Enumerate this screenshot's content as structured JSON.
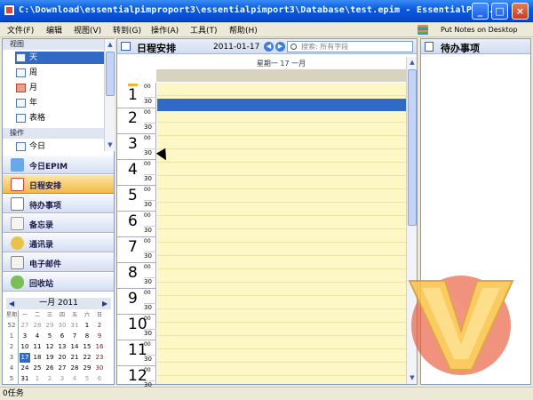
{
  "window": {
    "title": "C:\\Download\\essentialpimproport3\\essentialpimport3\\Database\\test.epim - EssentialPIM...",
    "minimize": "_",
    "maximize": "□",
    "close": "×"
  },
  "menu": {
    "items": [
      "文件(F)",
      "编辑",
      "视图(V)",
      "转到(G)",
      "操作(A)",
      "工具(T)",
      "帮助(H)"
    ],
    "notes_button": "Put Notes on Desktop"
  },
  "left": {
    "views_header": "视图",
    "views": [
      "天",
      "周",
      "月",
      "年",
      "表格"
    ],
    "actions_header": "操作",
    "actions": [
      "今日"
    ],
    "nav": [
      "今日EPIM",
      "日程安排",
      "待办事项",
      "备忘录",
      "通讯录",
      "电子邮件",
      "回收站"
    ],
    "active_nav": "日程安排",
    "minical": {
      "month_label": "一月 2011",
      "prev": "◀",
      "next": "▶",
      "header": [
        "星期",
        "一",
        "二",
        "三",
        "四",
        "五",
        "六",
        "日"
      ],
      "weeks": [
        [
          "52",
          "27",
          "28",
          "29",
          "30",
          "31",
          "1",
          "2"
        ],
        [
          "1",
          "3",
          "4",
          "5",
          "6",
          "7",
          "8",
          "9"
        ],
        [
          "2",
          "10",
          "11",
          "12",
          "13",
          "14",
          "15",
          "16"
        ],
        [
          "3",
          "17",
          "18",
          "19",
          "20",
          "21",
          "22",
          "23"
        ],
        [
          "4",
          "24",
          "25",
          "26",
          "27",
          "28",
          "29",
          "30"
        ],
        [
          "5",
          "31",
          "1",
          "2",
          "3",
          "4",
          "5",
          "6"
        ]
      ],
      "today": "17"
    }
  },
  "calendar": {
    "title": "日程安排",
    "date": "2011-01-17",
    "search_placeholder": "搜索: 所有字段",
    "day_header": "星期一 17 一月",
    "hours": [
      "1",
      "2",
      "3",
      "4",
      "5",
      "6",
      "7",
      "8",
      "9",
      "10",
      "11",
      "12"
    ],
    "min00": "00",
    "min30": "30"
  },
  "todo": {
    "title": "待办事项"
  },
  "status": {
    "text": "0任务"
  },
  "colors": {
    "titlebar": "#0a58e0",
    "selection": "#316ac5",
    "grid_bg": "#fcf7c5",
    "active_nav": "#f3b948"
  }
}
